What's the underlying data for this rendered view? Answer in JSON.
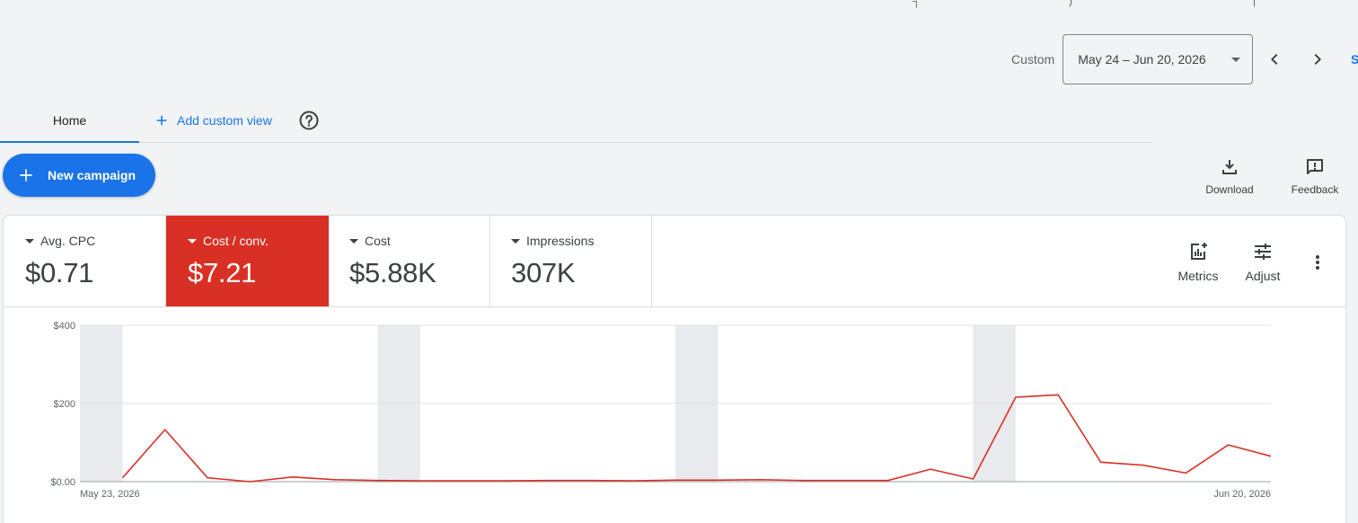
{
  "header": {
    "range_label": "Custom",
    "date_range": "May 24 – Jun 20, 2026",
    "cut_link_text": "S",
    "cut_top_text_left": "┐",
    "cut_top_text_mid": ")",
    "cut_top_text_right": "|"
  },
  "icons": {
    "prev": "chevron-left-icon",
    "next": "chevron-right-icon",
    "dropdown": "arrow-drop-down-icon",
    "add": "plus-icon",
    "help": "help-circle-icon",
    "download": "download-icon",
    "feedback": "feedback-icon",
    "metrics": "metrics-icon",
    "adjust": "tune-icon",
    "more": "more-vert-icon"
  },
  "tabs": {
    "home": "Home",
    "add_custom_view": "Add custom view"
  },
  "actions": {
    "new_campaign": "New campaign",
    "download": "Download",
    "feedback": "Feedback",
    "metrics": "Metrics",
    "adjust": "Adjust"
  },
  "scorecards": [
    {
      "name": "Avg. CPC",
      "value": "$0.71",
      "selected": false
    },
    {
      "name": "Cost / conv.",
      "value": "$7.21",
      "selected": true
    },
    {
      "name": "Cost",
      "value": "$5.88K",
      "selected": false
    },
    {
      "name": "Impressions",
      "value": "307K",
      "selected": false
    }
  ],
  "colors": {
    "accent": "#1a73e8",
    "selected_metric": "#d93025",
    "series_line": "#d93025",
    "weekend_band": "#e8eaed",
    "background": "#f1f3f4"
  },
  "chart_data": {
    "type": "line",
    "ylim": [
      0,
      400
    ],
    "yticks": [
      "$0.00",
      "$200",
      "$400"
    ],
    "ytick_values": [
      0,
      200,
      400
    ],
    "xtick_labels": [
      "May 23, 2026",
      "Jun 20, 2026"
    ],
    "grid": true,
    "x": [
      "May 24",
      "May 25",
      "May 26",
      "May 27",
      "May 28",
      "May 29",
      "May 30",
      "May 31",
      "Jun 1",
      "Jun 2",
      "Jun 3",
      "Jun 4",
      "Jun 5",
      "Jun 6",
      "Jun 7",
      "Jun 8",
      "Jun 9",
      "Jun 10",
      "Jun 11",
      "Jun 12",
      "Jun 13",
      "Jun 14",
      "Jun 15",
      "Jun 16",
      "Jun 17",
      "Jun 18",
      "Jun 19",
      "Jun 20"
    ],
    "series": [
      {
        "name": "Cost / conv.",
        "values": [
          10,
          133,
          10,
          0,
          12,
          5,
          3,
          2,
          2,
          2,
          3,
          3,
          2,
          4,
          4,
          5,
          3,
          3,
          3,
          32,
          7,
          216,
          222,
          50,
          42,
          22,
          94,
          65
        ]
      }
    ],
    "weekend_bands": [
      [
        "May 23",
        "May 24"
      ],
      [
        "May 30",
        "May 31"
      ],
      [
        "Jun 6",
        "Jun 7"
      ],
      [
        "Jun 13",
        "Jun 14"
      ]
    ]
  }
}
